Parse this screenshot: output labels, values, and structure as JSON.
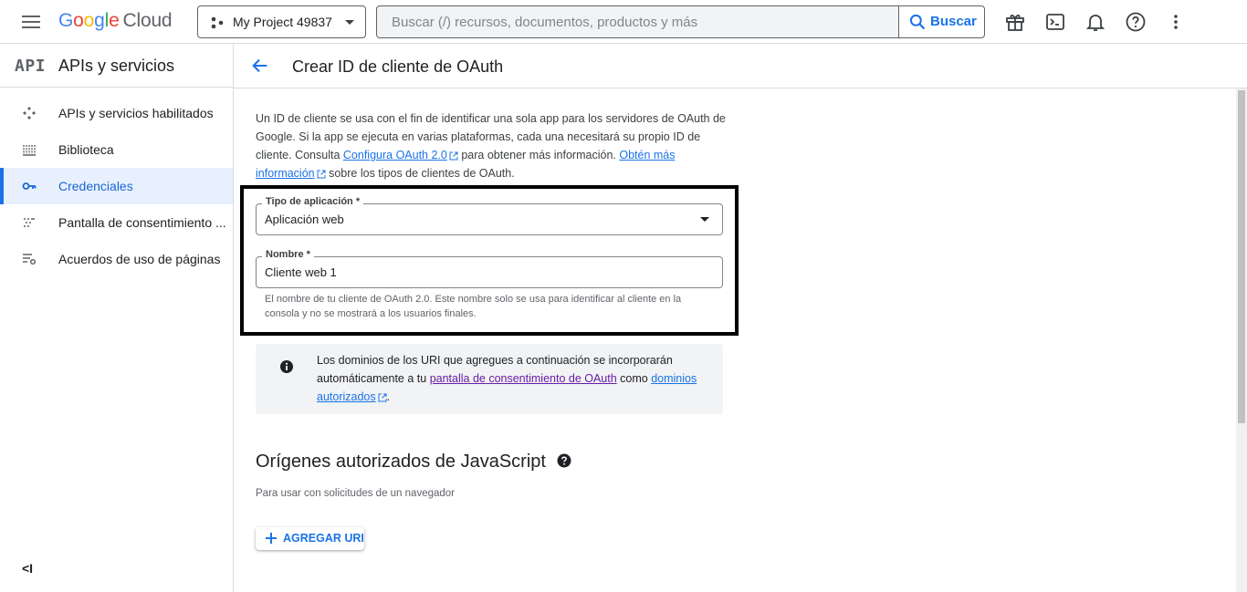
{
  "header": {
    "logo_letters": [
      "G",
      "o",
      "o",
      "g",
      "l",
      "e"
    ],
    "logo_suffix": "Cloud",
    "project_name": "My Project 49837",
    "search_placeholder": "Buscar (/) recursos, documentos, productos y más",
    "search_button": "Buscar",
    "icons": [
      "gift-icon",
      "terminal-icon",
      "bell-icon",
      "help-circle-icon",
      "more-vert-icon"
    ]
  },
  "sidebar": {
    "logo": "API",
    "title": "APIs y servicios",
    "items": [
      {
        "label": "APIs y servicios habilitados",
        "icon": "apis-icon",
        "active": false
      },
      {
        "label": "Biblioteca",
        "icon": "library-icon",
        "active": false
      },
      {
        "label": "Credenciales",
        "icon": "key-icon",
        "active": true
      },
      {
        "label": "Pantalla de consentimiento ...",
        "icon": "consent-icon",
        "active": false
      },
      {
        "label": "Acuerdos de uso de páginas",
        "icon": "settings-list-icon",
        "active": false
      }
    ],
    "collapse_label": "<I"
  },
  "main": {
    "title": "Crear ID de cliente de OAuth",
    "intro": {
      "text1": "Un ID de cliente se usa con el fin de identificar una sola app para los servidores de OAuth de Google. Si la app se ejecuta en varias plataformas, cada una necesitará su propio ID de cliente. Consulta ",
      "link1": "Configura OAuth 2.0",
      "text2": " para obtener más información. ",
      "link2": "Obtén más información",
      "text3": " sobre los tipos de clientes de OAuth."
    },
    "app_type": {
      "label": "Tipo de aplicación *",
      "value": "Aplicación web"
    },
    "name_field": {
      "label": "Nombre *",
      "value": "Cliente web 1",
      "hint": "El nombre de tu cliente de OAuth 2.0. Este nombre solo se usa para identificar al cliente en la consola y no se mostrará a los usuarios finales."
    },
    "info_box": {
      "text1": "Los dominios de los URI que agregues a continuación se incorporarán automáticamente a tu ",
      "link1": "pantalla de consentimiento de OAuth",
      "text2": " como ",
      "link2": "dominios autorizados",
      "text3": "."
    },
    "js_origins": {
      "title": "Orígenes autorizados de JavaScript",
      "subtitle": "Para usar con solicitudes de un navegador",
      "add_button": "AGREGAR URI"
    }
  },
  "colors": {
    "accent": "#1a73e8",
    "active_bg": "#e8f0fe",
    "visited_link": "#681da8"
  }
}
